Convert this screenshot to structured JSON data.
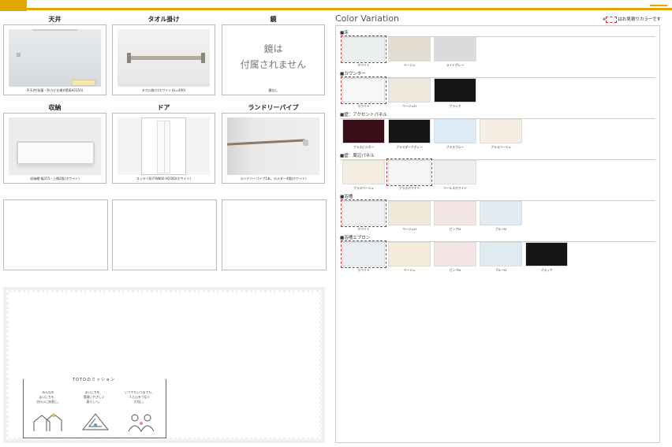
{
  "options": {
    "ceiling": {
      "heading": "天井",
      "caption": "平天井(抗菌・防カビ仕様)(壁高H2150)"
    },
    "towel": {
      "heading": "タオル掛け",
      "caption": "タオル掛け(ホワイト)(L=400)"
    },
    "mirror": {
      "heading": "鏡",
      "text_line1": "鏡は",
      "text_line2": "付属されません",
      "caption": "鏡なし"
    },
    "storage": {
      "heading": "収納",
      "caption": "収納棚 幅375・上側2段(ホワイト)"
    },
    "door": {
      "heading": "ドア",
      "caption": "スッキリ折戸W800 H2000(ホワイト)"
    },
    "laundry": {
      "heading": "ランドリーパイプ",
      "caption": "ランドリーパイプ1本、ホルダー4個(ホワイト)"
    }
  },
  "mission": {
    "title": "TOTOのミッション",
    "col1": "みんなの\nまいにちを、\nきれいに快適に。",
    "col2": "まいにちを、\n環境にやさしい\n暮らしへ。",
    "col3": "いつでもいつまでも、\n人と心をつなぐ\n大切に。"
  },
  "color_variation": {
    "title": "Color Variation",
    "note": "はお見積りカラーです",
    "sections": [
      {
        "label": "■床",
        "swatches": [
          {
            "name": "ホワイト",
            "color": "#eceff0",
            "selected": true
          },
          {
            "name": "ベージュ",
            "color": "#e3dcd0",
            "selected": false
          },
          {
            "name": "ライトグレー",
            "color": "#d9dbdc",
            "selected": false
          }
        ]
      },
      {
        "label": "■カウンター",
        "swatches": [
          {
            "name": "ホワイト",
            "color": "#f7f7f7",
            "selected": true
          },
          {
            "name": "ベージュH",
            "color": "#efe9dc",
            "selected": false
          },
          {
            "name": "ブラック",
            "color": "#141414",
            "selected": false
          }
        ]
      },
      {
        "label": "■壁：アクセントパネル",
        "swatches": [
          {
            "name": "プラスビルボー",
            "color": "#3a0e16",
            "selected": false
          },
          {
            "name": "プラスダークグレー",
            "color": "#151515",
            "selected": false
          },
          {
            "name": "プラスブルー",
            "color": "#dcebf5",
            "selected": false
          },
          {
            "name": "プラスベージュ",
            "color": "#f5eee3",
            "selected": false
          }
        ]
      },
      {
        "label": "■壁：周辺パネル",
        "swatches": [
          {
            "name": "プラスベージュ",
            "color": "#f3ece0",
            "selected": false
          },
          {
            "name": "プラスホワイト",
            "color": "#f5f6f7",
            "selected": true
          },
          {
            "name": "ペールスホワイト",
            "color": "#eeeeed",
            "selected": false
          }
        ]
      },
      {
        "label": "■浴槽",
        "swatches": [
          {
            "name": "ホワイト",
            "color": "#eef0f1",
            "selected": true
          },
          {
            "name": "ベージュH",
            "color": "#f1ead8",
            "selected": false
          },
          {
            "name": "ピンクN",
            "color": "#f3e6e4",
            "selected": false
          },
          {
            "name": "ブルーN",
            "color": "#e2ecf2",
            "selected": false
          }
        ]
      },
      {
        "label": "■浴槽エプロン",
        "swatches": [
          {
            "name": "ホワイト",
            "color": "#eceff1",
            "selected": true
          },
          {
            "name": "ベージュ",
            "color": "#f4ecd8",
            "selected": false
          },
          {
            "name": "ピンクN",
            "color": "#f4e6e6",
            "selected": false
          },
          {
            "name": "ブルーN",
            "color": "#e0eaf1",
            "selected": false
          },
          {
            "name": "ブラック",
            "color": "#141414",
            "selected": false
          }
        ]
      }
    ]
  }
}
